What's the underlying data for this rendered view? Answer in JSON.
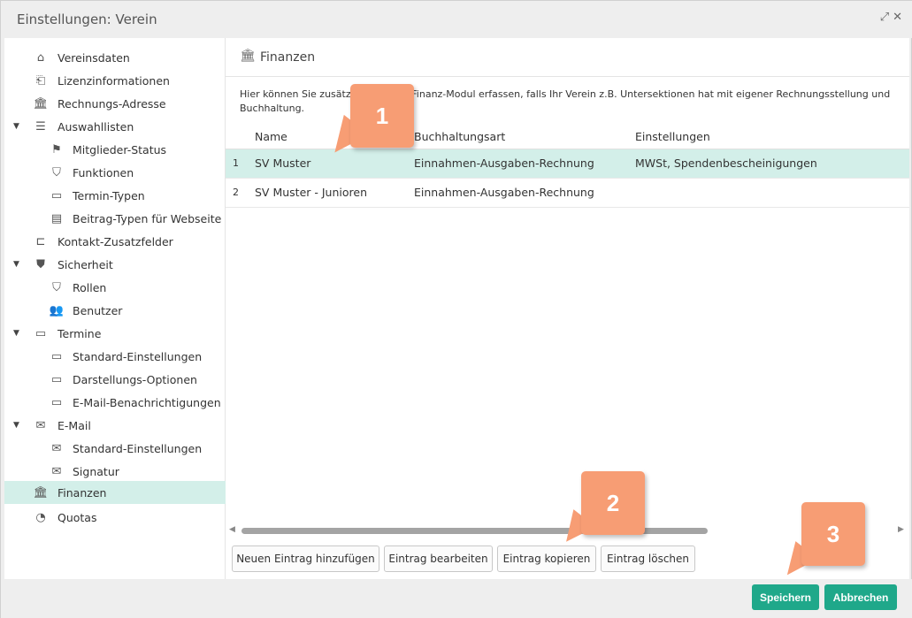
{
  "window": {
    "title": "Einstellungen: Verein",
    "expand_icon": "expand-icon",
    "close_icon": "close-icon"
  },
  "sidebar": {
    "items": [
      {
        "label": "Vereinsdaten",
        "icon": "home-icon"
      },
      {
        "label": "Lizenzinformationen",
        "icon": "bag-icon"
      },
      {
        "label": "Rechnungs-Adresse",
        "icon": "bank-icon"
      },
      {
        "label": "Auswahllisten",
        "icon": "list-icon"
      },
      {
        "label": "Mitglieder-Status",
        "icon": "flag-icon"
      },
      {
        "label": "Funktionen",
        "icon": "shield-icon"
      },
      {
        "label": "Termin-Typen",
        "icon": "calendar-icon"
      },
      {
        "label": "Beitrag-Typen für Webseite",
        "icon": "document-icon"
      },
      {
        "label": "Kontakt-Zusatzfelder",
        "icon": "field-add-icon"
      },
      {
        "label": "Sicherheit",
        "icon": "security-shield-icon"
      },
      {
        "label": "Rollen",
        "icon": "role-shield-icon"
      },
      {
        "label": "Benutzer",
        "icon": "users-icon"
      },
      {
        "label": "Termine",
        "icon": "calendar-icon"
      },
      {
        "label": "Standard-Einstellungen",
        "icon": "calendar-icon"
      },
      {
        "label": "Darstellungs-Optionen",
        "icon": "calendar-icon"
      },
      {
        "label": "E-Mail-Benachrichtigungen",
        "icon": "calendar-icon"
      },
      {
        "label": "E-Mail",
        "icon": "mail-icon"
      },
      {
        "label": "Standard-Einstellungen",
        "icon": "mail-icon"
      },
      {
        "label": "Signatur",
        "icon": "mail-icon"
      },
      {
        "label": "Finanzen",
        "icon": "bank-icon"
      },
      {
        "label": "Quotas",
        "icon": "pie-chart-icon"
      }
    ]
  },
  "panel": {
    "title": "Finanzen",
    "description": "Hier können Sie zusätzli          en für das Finanz-Modul erfassen, falls Ihr Verein z.B. Untersektionen hat mit eigener Rechnungsstellung und Buchhaltung."
  },
  "table": {
    "columns": [
      "Name",
      "Buchhaltungsart",
      "Einstellungen"
    ],
    "rows": [
      {
        "num": "1",
        "name": "SV Muster",
        "type": "Einnahmen-Ausgaben-Rechnung",
        "settings": "MWSt, Spendenbescheinigungen"
      },
      {
        "num": "2",
        "name": "SV Muster - Junioren",
        "type": "Einnahmen-Ausgaben-Rechnung",
        "settings": ""
      }
    ]
  },
  "actions": {
    "add": "Neuen Eintrag hinzufügen",
    "edit": "Eintrag bearbeiten",
    "copy": "Eintrag kopieren",
    "delete": "Eintrag löschen"
  },
  "footer": {
    "save": "Speichern",
    "cancel": "Abbrechen"
  },
  "callouts": [
    "1",
    "2",
    "3"
  ],
  "colors": {
    "accent_green": "#1fa88a",
    "selection": "#d3efe9",
    "callout": "#f79d74"
  }
}
